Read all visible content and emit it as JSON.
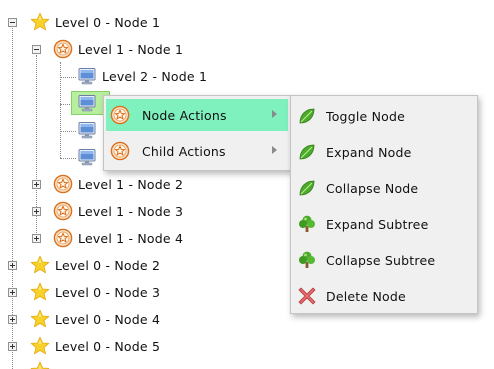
{
  "tree": {
    "nodes": [
      {
        "label": "Level 0 - Node 1",
        "icon": "star-icon",
        "expander": "minus"
      },
      {
        "label": "Level 1 - Node 1",
        "icon": "star-badge-icon",
        "expander": "minus"
      },
      {
        "label": "Level 2 - Node 1",
        "icon": "monitor-icon"
      },
      {
        "label": "",
        "icon": "monitor-icon",
        "selected": true
      },
      {
        "label": "",
        "icon": "monitor-icon"
      },
      {
        "label": "",
        "icon": "monitor-icon"
      },
      {
        "label": "Level 1 - Node 2",
        "icon": "star-badge-icon",
        "expander": "plus"
      },
      {
        "label": "Level 1 - Node 3",
        "icon": "star-badge-icon",
        "expander": "plus"
      },
      {
        "label": "Level 1 - Node 4",
        "icon": "star-badge-icon",
        "expander": "plus"
      },
      {
        "label": "Level 0 - Node 2",
        "icon": "star-icon",
        "expander": "plus"
      },
      {
        "label": "Level 0 - Node 3",
        "icon": "star-icon",
        "expander": "plus"
      },
      {
        "label": "Level 0 - Node 4",
        "icon": "star-icon",
        "expander": "plus"
      },
      {
        "label": "Level 0 - Node 5",
        "icon": "star-icon",
        "expander": "plus"
      }
    ]
  },
  "context_menu": {
    "items": [
      {
        "label": "Node Actions",
        "icon": "star-badge-icon",
        "has_submenu": true,
        "highlighted": true
      },
      {
        "label": "Child Actions",
        "icon": "star-badge-icon",
        "has_submenu": true
      }
    ]
  },
  "submenu": {
    "items": [
      {
        "label": "Toggle Node",
        "icon": "leaf-icon"
      },
      {
        "label": "Expand Node",
        "icon": "leaf-icon"
      },
      {
        "label": "Collapse Node",
        "icon": "leaf-icon"
      },
      {
        "label": "Expand Subtree",
        "icon": "tree-icon"
      },
      {
        "label": "Collapse Subtree",
        "icon": "tree-icon"
      },
      {
        "label": "Delete Node",
        "icon": "delete-x-icon"
      }
    ]
  },
  "colors": {
    "highlight": "#7ff1bf",
    "selection": "#b7ef9e",
    "menu_background": "#f0f0f0",
    "star": "#f8d12b",
    "badge": "#e07a2c",
    "leaf": "#4caa2a",
    "delete": "#e05555"
  }
}
